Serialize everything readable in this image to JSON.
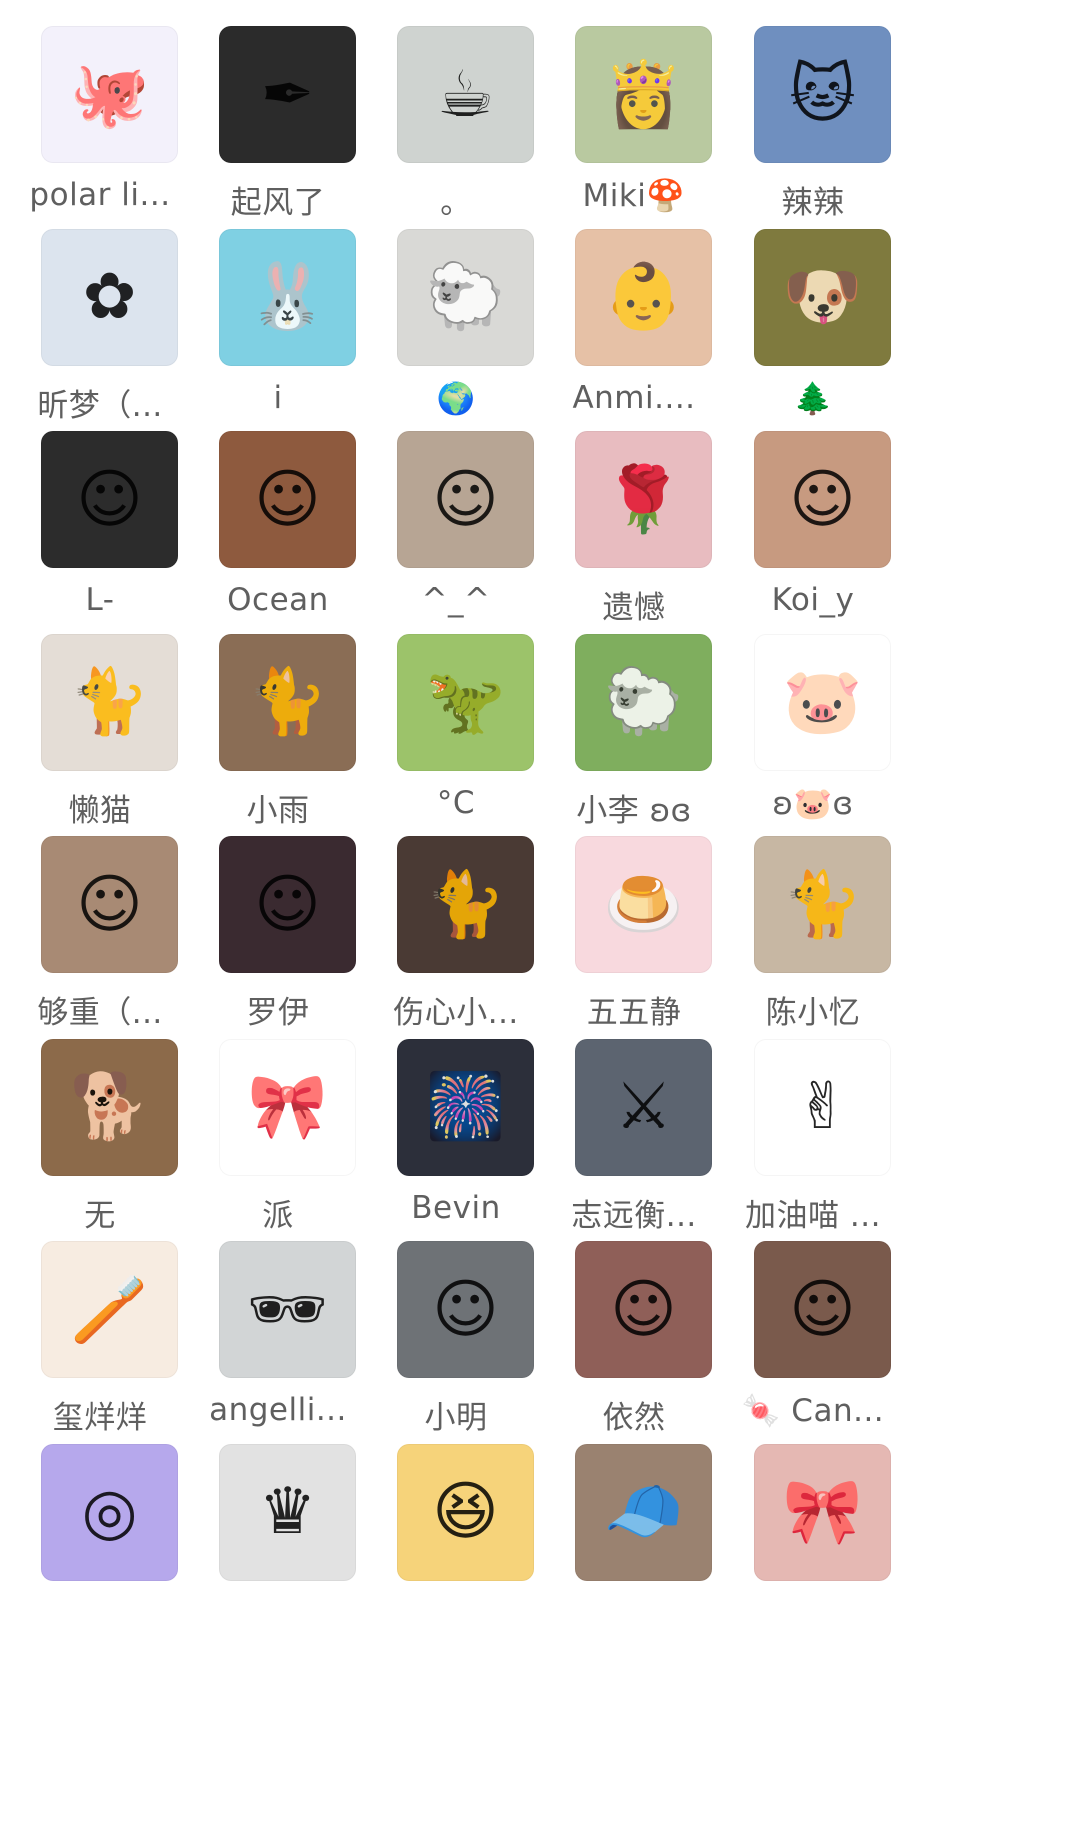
{
  "members": [
    {
      "name": "polar li...",
      "icon": "octopus-sticker-icon",
      "glyph": "🐙",
      "bg": "#f3f1fb"
    },
    {
      "name": "起风了",
      "icon": "anime-boy-icon",
      "glyph": "✒",
      "bg": "#2b2b2b"
    },
    {
      "name": "。",
      "icon": "girl-cafe-icon",
      "glyph": "☕",
      "bg": "#cfd3d0"
    },
    {
      "name": "Miki🍄",
      "icon": "anime-girl-icon",
      "glyph": "👸",
      "bg": "#b9c9a0"
    },
    {
      "name": "辣辣",
      "icon": "white-cat-icon",
      "glyph": "🐱",
      "bg": "#6f8fbf"
    },
    {
      "name": "昕梦（...",
      "icon": "anime-white-hair-icon",
      "glyph": "✿",
      "bg": "#dce4ee"
    },
    {
      "name": "i",
      "icon": "my-melody-icon",
      "glyph": "🐰",
      "bg": "#7fd0e3"
    },
    {
      "name": "🌍",
      "icon": "plush-sheep-icon",
      "glyph": "🐑",
      "bg": "#d9d9d6"
    },
    {
      "name": "Anmi....",
      "icon": "baby-face-icon",
      "glyph": "👶",
      "bg": "#e6c1a6"
    },
    {
      "name": "🌲",
      "icon": "dog-forest-icon",
      "glyph": "🐶",
      "bg": "#7f7a3e"
    },
    {
      "name": "L-",
      "icon": "woman-portrait-icon",
      "glyph": "☺",
      "bg": "#2c2c2c"
    },
    {
      "name": "Ocean",
      "icon": "woman-curly-icon",
      "glyph": "☺",
      "bg": "#8e5a3e"
    },
    {
      "name": "^_^",
      "icon": "child-photo-icon",
      "glyph": "☺",
      "bg": "#b7a594"
    },
    {
      "name": "遗憾",
      "icon": "anime-rose-icon",
      "glyph": "🌹",
      "bg": "#e8bcc0"
    },
    {
      "name": "Koi_y",
      "icon": "woman-portrait-icon",
      "glyph": "☺",
      "bg": "#c79a80"
    },
    {
      "name": "懒猫",
      "icon": "woman-with-cat-icon",
      "glyph": "🐈",
      "bg": "#e4ddd6"
    },
    {
      "name": "小雨",
      "icon": "woman-with-cat-icon",
      "glyph": "🐈",
      "bg": "#8a6d55"
    },
    {
      "name": "°C",
      "icon": "green-costume-icon",
      "glyph": "🦖",
      "bg": "#9cc36a"
    },
    {
      "name": "小李 ʚɞ",
      "icon": "woman-meadow-icon",
      "glyph": "🐑",
      "bg": "#7fae5e"
    },
    {
      "name": "ʚ🐷ɞ",
      "icon": "pig-cartoon-icon",
      "glyph": "🐷",
      "bg": "#ffffff"
    },
    {
      "name": "够重（...",
      "icon": "woman-portrait-icon",
      "glyph": "☺",
      "bg": "#a88a74"
    },
    {
      "name": "罗伊",
      "icon": "woman-pink-hat-icon",
      "glyph": "☺",
      "bg": "#3a2a30"
    },
    {
      "name": "伤心小...",
      "icon": "woman-with-cat-icon",
      "glyph": "🐈",
      "bg": "#4a3a34"
    },
    {
      "name": "五五静",
      "icon": "pudding-dog-icon",
      "glyph": "🍮",
      "bg": "#f8d9de"
    },
    {
      "name": "陈小忆",
      "icon": "woman-with-cat-icon",
      "glyph": "🐈",
      "bg": "#c7b7a3"
    },
    {
      "name": "无",
      "icon": "corgi-icon",
      "glyph": "🐕",
      "bg": "#8c6a4a"
    },
    {
      "name": "派",
      "icon": "hello-kitty-icon",
      "glyph": "🎀",
      "bg": "#ffffff"
    },
    {
      "name": "Bevin",
      "icon": "hello-kitty-plush-icon",
      "glyph": "🎆",
      "bg": "#2c2f3a"
    },
    {
      "name": "志远衡...",
      "icon": "anime-boy-icon",
      "glyph": "⚔",
      "bg": "#5c6470"
    },
    {
      "name": "加油喵 ...",
      "icon": "cartoon-girl-icon",
      "glyph": "✌",
      "bg": "#ffffff"
    },
    {
      "name": "玺烊烊",
      "icon": "cartoon-boy-icon",
      "glyph": "🪥",
      "bg": "#f7ece1"
    },
    {
      "name": "angelli...",
      "icon": "woman-sunglasses-icon",
      "glyph": "🕶",
      "bg": "#d2d5d6"
    },
    {
      "name": "小明",
      "icon": "man-photo-icon",
      "glyph": "☺",
      "bg": "#6e7276"
    },
    {
      "name": "依然",
      "icon": "woman-portrait-icon",
      "glyph": "☺",
      "bg": "#8f5f58"
    },
    {
      "name": "🍬 Can...",
      "icon": "woman-beret-icon",
      "glyph": "☺",
      "bg": "#7a5a4c"
    },
    {
      "name": "",
      "icon": "rainbow-circle-icon",
      "glyph": "◎",
      "bg": "#b6a8ec"
    },
    {
      "name": "",
      "icon": "woman-crown-icon",
      "glyph": "♛",
      "bg": "#e2e2e2"
    },
    {
      "name": "",
      "icon": "anime-laughing-icon",
      "glyph": "😆",
      "bg": "#f6d37a"
    },
    {
      "name": "",
      "icon": "woman-cap-icon",
      "glyph": "🧢",
      "bg": "#9a8270"
    },
    {
      "name": "",
      "icon": "hello-kitty-plush-icon",
      "glyph": "🎀",
      "bg": "#e5b8b3"
    }
  ]
}
